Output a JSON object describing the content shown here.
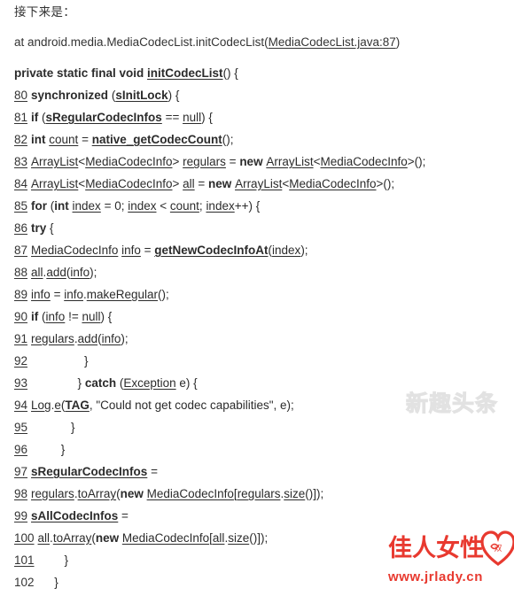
{
  "intro": {
    "text": "接下来是："
  },
  "stack_trace": {
    "prefix": "at android.media.MediaCodecList.initCodecList(",
    "link": "MediaCodecList.java:87",
    "suffix": ")"
  },
  "code": {
    "signature": {
      "number": "",
      "parts": [
        {
          "t": "private static final void ",
          "s": "b"
        },
        {
          "t": "initCodecList",
          "s": "bu"
        },
        {
          "t": "() {",
          "s": ""
        }
      ]
    },
    "lines": [
      {
        "number": "80",
        "underline_number": true,
        "indent": "",
        "parts": [
          {
            "t": "synchronized ",
            "s": "b"
          },
          {
            "t": "(",
            "s": ""
          },
          {
            "t": "sInitLock",
            "s": "bu"
          },
          {
            "t": ") {",
            "s": ""
          }
        ]
      },
      {
        "number": "81",
        "underline_number": true,
        "indent": "",
        "parts": [
          {
            "t": "if ",
            "s": "b"
          },
          {
            "t": "(",
            "s": ""
          },
          {
            "t": "sRegularCodecInfos",
            "s": "bu"
          },
          {
            "t": " == ",
            "s": ""
          },
          {
            "t": "null",
            "s": "u"
          },
          {
            "t": ") {",
            "s": ""
          }
        ]
      },
      {
        "number": "82",
        "underline_number": true,
        "indent": "",
        "parts": [
          {
            "t": "int ",
            "s": "b"
          },
          {
            "t": "count",
            "s": "u"
          },
          {
            "t": " = ",
            "s": ""
          },
          {
            "t": "native_getCodecCount",
            "s": "bu"
          },
          {
            "t": "();",
            "s": ""
          }
        ]
      },
      {
        "number": "83",
        "underline_number": true,
        "indent": "",
        "parts": [
          {
            "t": "ArrayList",
            "s": "u"
          },
          {
            "t": "<",
            "s": ""
          },
          {
            "t": "MediaCodecInfo",
            "s": "u"
          },
          {
            "t": "> ",
            "s": ""
          },
          {
            "t": "regulars",
            "s": "u"
          },
          {
            "t": " = ",
            "s": ""
          },
          {
            "t": "new ",
            "s": "b"
          },
          {
            "t": "ArrayList",
            "s": "u"
          },
          {
            "t": "<",
            "s": ""
          },
          {
            "t": "MediaCodecInfo",
            "s": "u"
          },
          {
            "t": ">();",
            "s": ""
          }
        ]
      },
      {
        "number": "84",
        "underline_number": true,
        "indent": "",
        "parts": [
          {
            "t": "ArrayList",
            "s": "u"
          },
          {
            "t": "<",
            "s": ""
          },
          {
            "t": "MediaCodecInfo",
            "s": "u"
          },
          {
            "t": "> ",
            "s": ""
          },
          {
            "t": "all",
            "s": "u"
          },
          {
            "t": " = ",
            "s": ""
          },
          {
            "t": "new ",
            "s": "b"
          },
          {
            "t": "ArrayList",
            "s": "u"
          },
          {
            "t": "<",
            "s": ""
          },
          {
            "t": "MediaCodecInfo",
            "s": "u"
          },
          {
            "t": ">();",
            "s": ""
          }
        ]
      },
      {
        "number": "85",
        "underline_number": true,
        "indent": "",
        "parts": [
          {
            "t": "for ",
            "s": "b"
          },
          {
            "t": "(",
            "s": ""
          },
          {
            "t": "int ",
            "s": "b"
          },
          {
            "t": "index",
            "s": "u"
          },
          {
            "t": " = 0; ",
            "s": ""
          },
          {
            "t": "index",
            "s": "u"
          },
          {
            "t": " < ",
            "s": ""
          },
          {
            "t": "count",
            "s": "u"
          },
          {
            "t": "; ",
            "s": ""
          },
          {
            "t": "index",
            "s": "u"
          },
          {
            "t": "++) {",
            "s": ""
          }
        ]
      },
      {
        "number": "86",
        "underline_number": true,
        "indent": "",
        "parts": [
          {
            "t": "try ",
            "s": "b"
          },
          {
            "t": "{",
            "s": ""
          }
        ]
      },
      {
        "number": "87",
        "underline_number": true,
        "indent": "",
        "parts": [
          {
            "t": "MediaCodecInfo",
            "s": "u"
          },
          {
            "t": " ",
            "s": ""
          },
          {
            "t": "info",
            "s": "u"
          },
          {
            "t": " = ",
            "s": ""
          },
          {
            "t": "getNewCodecInfoAt",
            "s": "bu"
          },
          {
            "t": "(",
            "s": ""
          },
          {
            "t": "index",
            "s": "u"
          },
          {
            "t": ");",
            "s": ""
          }
        ]
      },
      {
        "number": "88",
        "underline_number": true,
        "indent": "",
        "parts": [
          {
            "t": "all",
            "s": "u"
          },
          {
            "t": ".",
            "s": ""
          },
          {
            "t": "add",
            "s": "u"
          },
          {
            "t": "(",
            "s": ""
          },
          {
            "t": "info",
            "s": "u"
          },
          {
            "t": ");",
            "s": ""
          }
        ]
      },
      {
        "number": "89",
        "underline_number": true,
        "indent": "",
        "parts": [
          {
            "t": "info",
            "s": "u"
          },
          {
            "t": " = ",
            "s": ""
          },
          {
            "t": "info",
            "s": "u"
          },
          {
            "t": ".",
            "s": ""
          },
          {
            "t": "makeRegular",
            "s": "u"
          },
          {
            "t": "();",
            "s": ""
          }
        ]
      },
      {
        "number": "90",
        "underline_number": true,
        "indent": "",
        "parts": [
          {
            "t": "if ",
            "s": "b"
          },
          {
            "t": "(",
            "s": ""
          },
          {
            "t": "info",
            "s": "u"
          },
          {
            "t": " != ",
            "s": ""
          },
          {
            "t": "null",
            "s": "u"
          },
          {
            "t": ") {",
            "s": ""
          }
        ]
      },
      {
        "number": "91",
        "underline_number": true,
        "indent": "",
        "parts": [
          {
            "t": "regulars",
            "s": "u"
          },
          {
            "t": ".",
            "s": ""
          },
          {
            "t": "add",
            "s": "u"
          },
          {
            "t": "(",
            "s": ""
          },
          {
            "t": "info",
            "s": "u"
          },
          {
            "t": ");",
            "s": ""
          }
        ]
      },
      {
        "number": "92",
        "underline_number": true,
        "indent": "                ",
        "parts": [
          {
            "t": "}",
            "s": ""
          }
        ]
      },
      {
        "number": "93",
        "underline_number": true,
        "indent": "              ",
        "parts": [
          {
            "t": "} ",
            "s": ""
          },
          {
            "t": "catch ",
            "s": "b"
          },
          {
            "t": "(",
            "s": ""
          },
          {
            "t": "Exception",
            "s": "u"
          },
          {
            "t": " e) {",
            "s": ""
          }
        ]
      },
      {
        "number": "94",
        "underline_number": true,
        "indent": "",
        "parts": [
          {
            "t": "Log",
            "s": "u"
          },
          {
            "t": ".",
            "s": ""
          },
          {
            "t": "e",
            "s": "u"
          },
          {
            "t": "(",
            "s": ""
          },
          {
            "t": "TAG",
            "s": "bu"
          },
          {
            "t": ", \"Could not get codec capabilities\", e);",
            "s": ""
          }
        ]
      },
      {
        "number": "95",
        "underline_number": true,
        "indent": "            ",
        "parts": [
          {
            "t": "}",
            "s": ""
          }
        ]
      },
      {
        "number": "96",
        "underline_number": true,
        "indent": "         ",
        "parts": [
          {
            "t": "}",
            "s": ""
          }
        ]
      },
      {
        "number": "97",
        "underline_number": true,
        "indent": "",
        "parts": [
          {
            "t": "sRegularCodecInfos",
            "s": "bu"
          },
          {
            "t": " =",
            "s": ""
          }
        ]
      },
      {
        "number": "98",
        "underline_number": true,
        "indent": "",
        "parts": [
          {
            "t": "regulars",
            "s": "u"
          },
          {
            "t": ".",
            "s": ""
          },
          {
            "t": "toArray",
            "s": "u"
          },
          {
            "t": "(",
            "s": ""
          },
          {
            "t": "new ",
            "s": "b"
          },
          {
            "t": "MediaCodecInfo",
            "s": "u"
          },
          {
            "t": "[",
            "s": ""
          },
          {
            "t": "regulars",
            "s": "u"
          },
          {
            "t": ".",
            "s": ""
          },
          {
            "t": "size",
            "s": "u"
          },
          {
            "t": "()]);",
            "s": ""
          }
        ]
      },
      {
        "number": "99",
        "underline_number": true,
        "indent": "",
        "parts": [
          {
            "t": "sAllCodecInfos",
            "s": "bu"
          },
          {
            "t": " =",
            "s": ""
          }
        ]
      },
      {
        "number": "100",
        "underline_number": true,
        "indent": "",
        "parts": [
          {
            "t": "all",
            "s": "u"
          },
          {
            "t": ".",
            "s": ""
          },
          {
            "t": "toArray",
            "s": "u"
          },
          {
            "t": "(",
            "s": ""
          },
          {
            "t": "new ",
            "s": "b"
          },
          {
            "t": "MediaCodecInfo",
            "s": "u"
          },
          {
            "t": "[",
            "s": ""
          },
          {
            "t": "all",
            "s": "u"
          },
          {
            "t": ".",
            "s": ""
          },
          {
            "t": "size",
            "s": "u"
          },
          {
            "t": "()]);",
            "s": ""
          }
        ]
      },
      {
        "number": "101",
        "underline_number": true,
        "indent": "        ",
        "parts": [
          {
            "t": "}",
            "s": ""
          }
        ]
      },
      {
        "number": "102",
        "underline_number": false,
        "indent": "     ",
        "parts": [
          {
            "t": "}",
            "s": ""
          }
        ]
      }
    ]
  },
  "watermark": {
    "text": "新趣头条"
  },
  "brand": {
    "name": "佳人女性",
    "url": "www.jrlady.cn",
    "color": "#e8392f"
  }
}
